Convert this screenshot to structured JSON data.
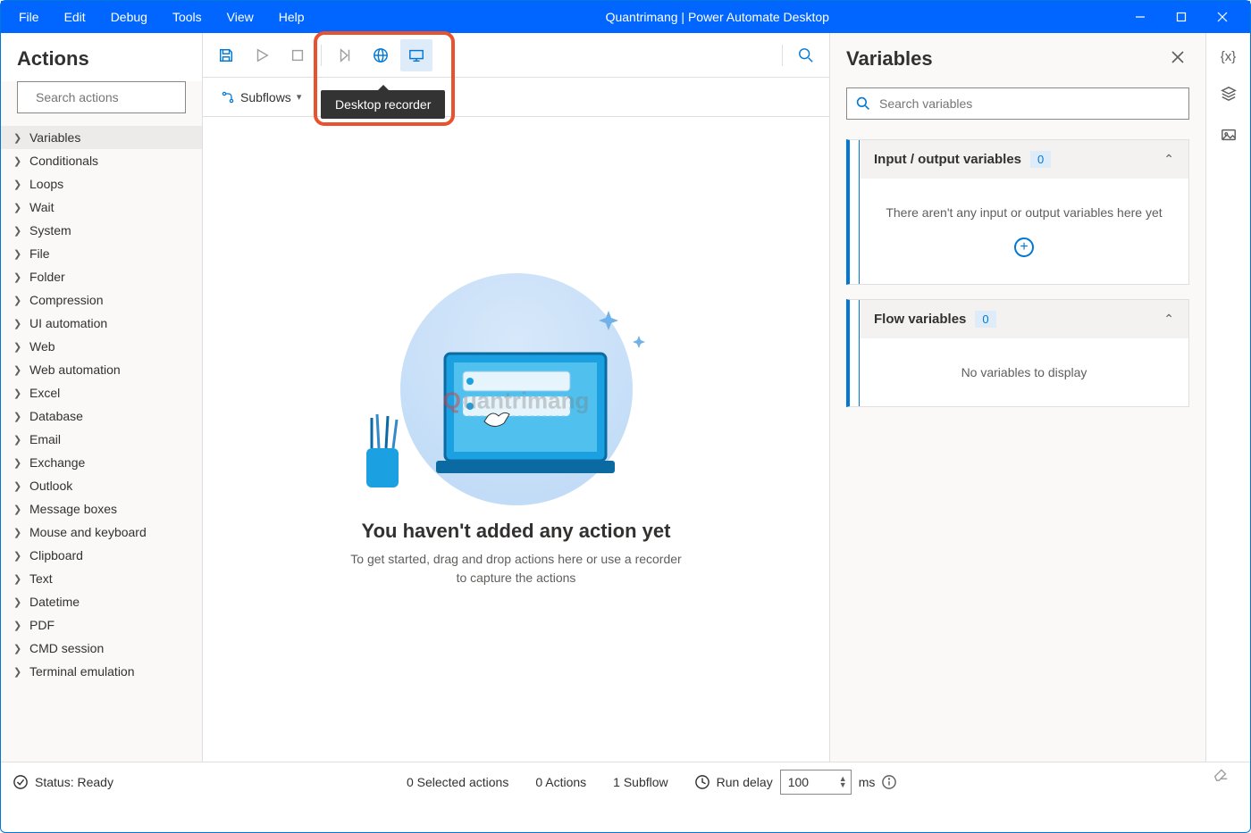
{
  "titlebar": {
    "menus": [
      "File",
      "Edit",
      "Debug",
      "Tools",
      "View",
      "Help"
    ],
    "title": "Quantrimang | Power Automate Desktop"
  },
  "actions_panel": {
    "title": "Actions",
    "search_placeholder": "Search actions",
    "categories": [
      "Variables",
      "Conditionals",
      "Loops",
      "Wait",
      "System",
      "File",
      "Folder",
      "Compression",
      "UI automation",
      "Web",
      "Web automation",
      "Excel",
      "Database",
      "Email",
      "Exchange",
      "Outlook",
      "Message boxes",
      "Mouse and keyboard",
      "Clipboard",
      "Text",
      "Datetime",
      "PDF",
      "CMD session",
      "Terminal emulation"
    ],
    "selected_index": 0
  },
  "toolbar": {
    "subflows_label": "Subflows",
    "tooltip": "Desktop recorder"
  },
  "empty_state": {
    "heading": "You haven't added any action yet",
    "sub": "To get started, drag and drop actions here or use a recorder to capture the actions"
  },
  "watermark": {
    "prefix": "Q",
    "rest": "uantrimang"
  },
  "variables_panel": {
    "title": "Variables",
    "search_placeholder": "Search variables",
    "io_section": {
      "title": "Input / output variables",
      "count": "0",
      "empty": "There aren't any input or output variables here yet"
    },
    "flow_section": {
      "title": "Flow variables",
      "count": "0",
      "empty": "No variables to display"
    }
  },
  "right_rail": {
    "vars_symbol": "{x}"
  },
  "status_bar": {
    "status_label": "Status: Ready",
    "selected": "0 Selected actions",
    "actions": "0 Actions",
    "subflow": "1 Subflow",
    "run_delay_label": "Run delay",
    "run_delay_value": "100",
    "run_delay_unit": "ms"
  }
}
